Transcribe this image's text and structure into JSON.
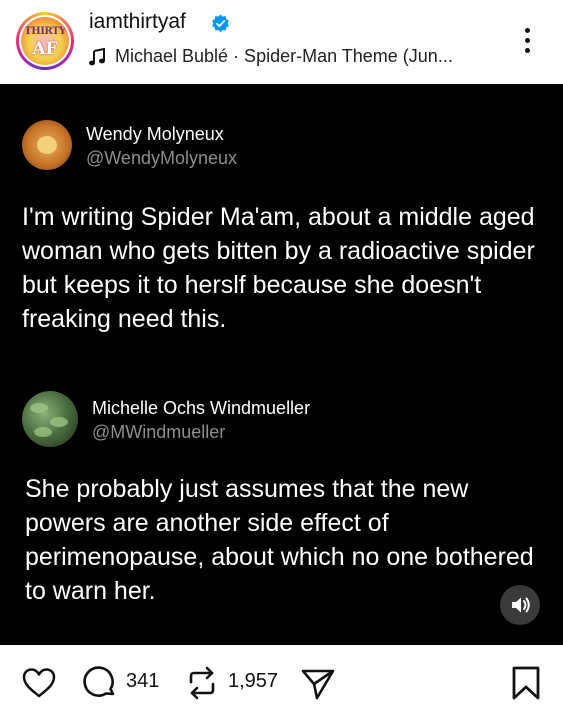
{
  "header": {
    "avatar_text_top": "THIRTY",
    "avatar_text_bottom": "AF",
    "username": "iamthirtyaf",
    "verified": true,
    "music": "Michael Bublé · Spider-Man Theme (Jun..."
  },
  "post": {
    "tweets": [
      {
        "name": "Wendy Molyneux",
        "handle": "@WendyMolyneux",
        "text": "I'm writing Spider Ma'am, about a middle aged woman who gets bitten by a radioactive spider but keeps it to herslf because she doesn't freaking need this."
      },
      {
        "name": "Michelle Ochs Windmueller",
        "handle": "@MWindmueller",
        "text": "She probably just assumes that the new powers are another side effect of perimenopause, about which no one bothered to warn her."
      }
    ]
  },
  "actions": {
    "comments": "341",
    "reposts": "1,957"
  },
  "colors": {
    "verified_blue": "#0095f6",
    "media_bg": "#000000",
    "handle_gray": "#8e8e8e"
  },
  "icons": [
    "verified-badge-icon",
    "music-note-icon",
    "more-options-icon",
    "sound-icon",
    "heart-icon",
    "comment-icon",
    "repost-icon",
    "share-icon",
    "bookmark-icon"
  ]
}
